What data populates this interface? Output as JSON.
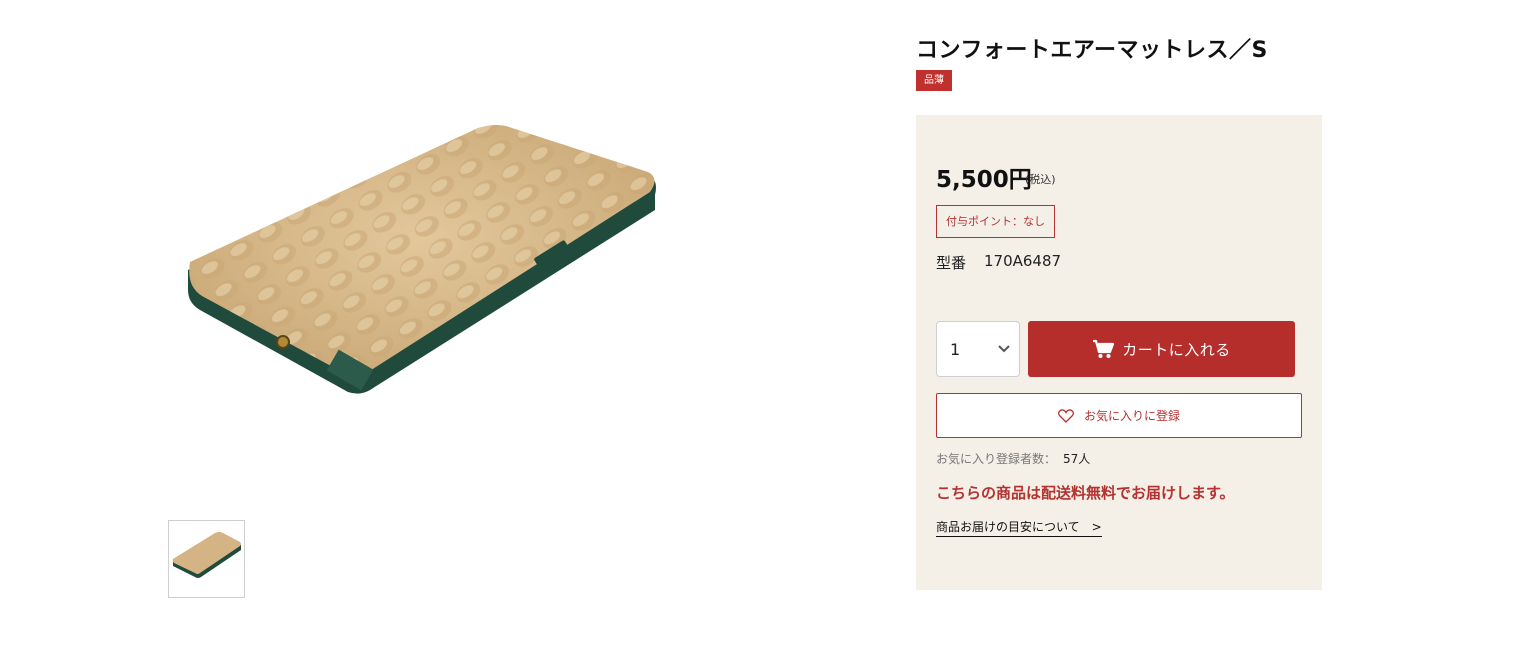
{
  "product": {
    "title": "コンフォートエアーマットレス／S",
    "badge": "品薄",
    "image_icon": "air-mattress-image",
    "price": "5,500円",
    "tax_note": "(税込)",
    "points_label": "付与ポイント：なし",
    "model_label": "型番",
    "model_value": "170A6487"
  },
  "purchase": {
    "quantity": "1",
    "cart_label": "カートに入れる",
    "cart_icon": "cart-icon",
    "favorite_label": "お気に入りに登録",
    "favorite_icon": "heart-icon"
  },
  "favorites": {
    "count_label": "お気に入り登録者数：",
    "count_value": "57人"
  },
  "shipping": {
    "notice": "こちらの商品は配送料無料でお届けします。",
    "delivery_link": "商品お届けの目安について　>"
  },
  "colors": {
    "accent": "#b52e2c",
    "panel_bg": "#f4efe7",
    "mattress_top": "#d8b98a",
    "mattress_side": "#1f4a3c"
  }
}
